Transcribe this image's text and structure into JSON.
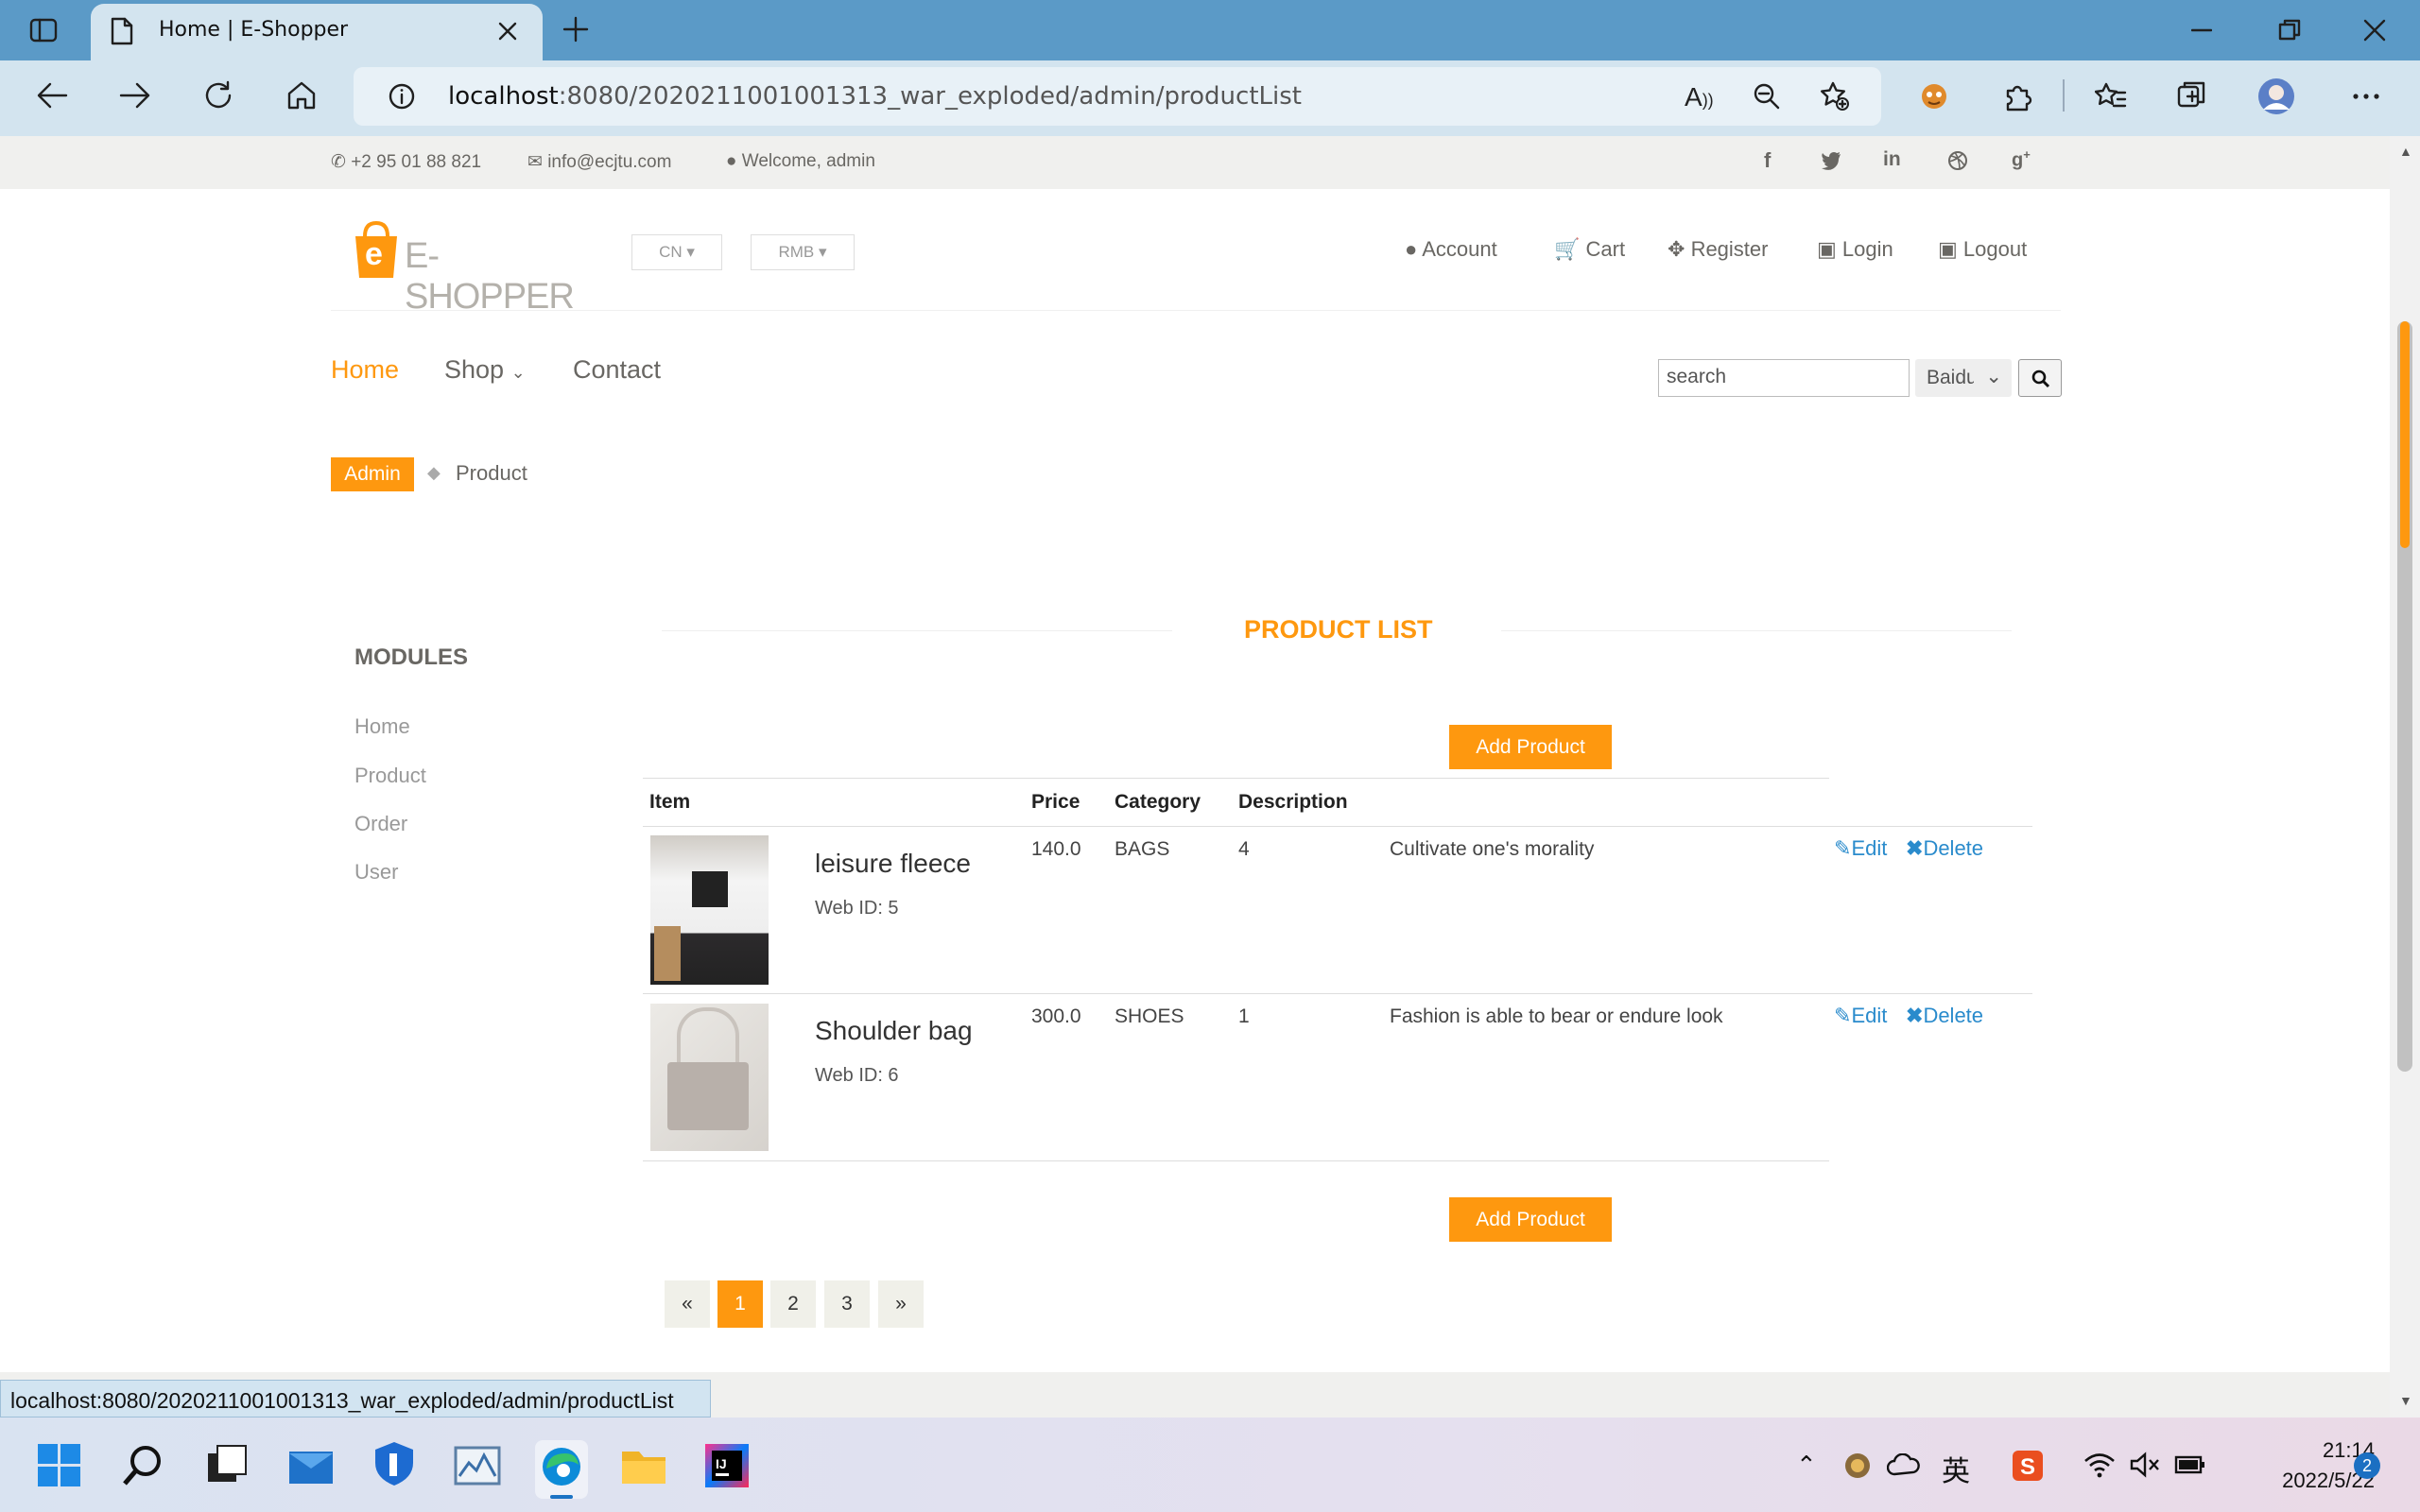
{
  "browser": {
    "tab_title": "Home | E-Shopper",
    "url_host": "localhost",
    "url_rest": ":8080/2020211001001313_war_exploded/admin/productList",
    "status_url": "localhost:8080/2020211001001313_war_exploded/admin/productList"
  },
  "topbar": {
    "phone": "+2 95 01 88 821",
    "email": "info@ecjtu.com",
    "welcome": "Welcome, admin"
  },
  "header": {
    "logo_text": "E-SHOPPER",
    "logo_letter": "e",
    "lang": "CN",
    "currency": "RMB",
    "account": "Account",
    "cart": "Cart",
    "register": "Register",
    "login": "Login",
    "logout": "Logout"
  },
  "nav": {
    "home": "Home",
    "shop": "Shop",
    "contact": "Contact",
    "search_placeholder": "search",
    "engine": "Baidu"
  },
  "breadcrumb": {
    "admin": "Admin",
    "current": "Product"
  },
  "sidebar": {
    "title": "MODULES",
    "items": [
      "Home",
      "Product",
      "Order",
      "User"
    ]
  },
  "main": {
    "title": "PRODUCT LIST",
    "add_label": "Add Product",
    "columns": [
      "Item",
      "Price",
      "Category",
      "Description"
    ],
    "products": [
      {
        "name": "leisure fleece",
        "webid": "Web ID: 5",
        "price": "140.0",
        "category": "BAGS",
        "qty": "4",
        "desc": "Cultivate one's morality",
        "edit": "Edit",
        "delete": "Delete"
      },
      {
        "name": "Shoulder bag",
        "webid": "Web ID: 6",
        "price": "300.0",
        "category": "SHOES",
        "qty": "1",
        "desc": "Fashion is able to bear or endure look",
        "edit": "Edit",
        "delete": "Delete"
      }
    ],
    "pages": [
      "«",
      "1",
      "2",
      "3",
      "»"
    ]
  },
  "taskbar": {
    "time": "21:14",
    "date": "2022/5/22",
    "ime": "英",
    "badge": "2"
  },
  "colors": {
    "accent": "#fe980f",
    "link": "#2a8bcc",
    "chrome": "#5b9ac7"
  }
}
